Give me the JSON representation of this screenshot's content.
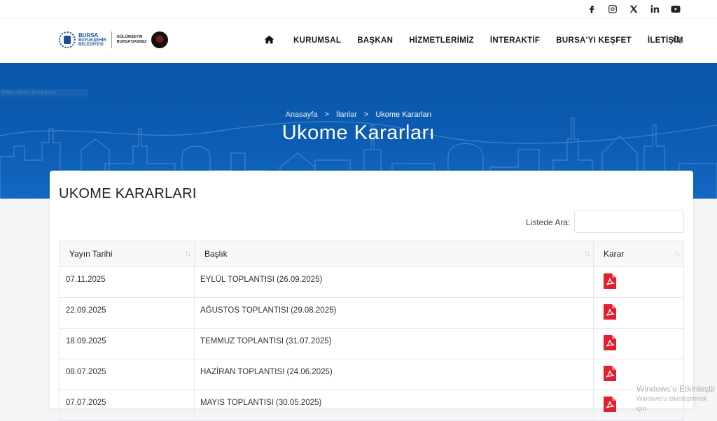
{
  "social": [
    "facebook-icon",
    "instagram-icon",
    "x-icon",
    "linkedin-icon",
    "youtube-icon"
  ],
  "logo": {
    "line1": "BURSA",
    "line2": "BÜYÜKŞEHİR",
    "line3": "BELEDİYESİ",
    "line4": "GÜLÜMSEYİN",
    "line5": "BURSA'DASINIZ"
  },
  "nav": {
    "items": [
      "KURUMSAL",
      "BAŞKAN",
      "HİZMETLERİMİZ",
      "İNTERAKTİF",
      "BURSA'YI KEŞFET",
      "İLETİŞİM"
    ]
  },
  "hero": {
    "faint_text": "Ortam Sesini Tama tema",
    "breadcrumb": [
      "Anasayfa",
      "İlanlar",
      "Ukome Kararları"
    ],
    "separator": ">",
    "title": "Ukome Kararları"
  },
  "card": {
    "title": "UKOME KARARLARI",
    "search_label": "Listede Ara:",
    "search_value": ""
  },
  "table": {
    "columns": [
      "Yayın Tarihi",
      "Başlık",
      "Karar"
    ],
    "rows": [
      {
        "date": "07.11.2025",
        "title": "EYLÜL TOPLANTISI (26.09.2025)"
      },
      {
        "date": "22.09.2025",
        "title": "AĞUSTOS TOPLANTISI (29.08.2025)"
      },
      {
        "date": "18.09.2025",
        "title": "TEMMUZ TOPLANTISI (31.07.2025)"
      },
      {
        "date": "08.07.2025",
        "title": "HAZİRAN TOPLANTISI (24.06.2025)"
      },
      {
        "date": "07.07.2025",
        "title": "MAYIS TOPLANTISI (30.05.2025)"
      }
    ]
  },
  "watermark": {
    "line1": "Windows'u Etkinleştir",
    "line2": "Windows'u etkinleştirmek için"
  },
  "colors": {
    "hero_blue": "#0b5cb3",
    "pdf_red": "#e0212d",
    "brand_blue": "#1c4f9a"
  }
}
